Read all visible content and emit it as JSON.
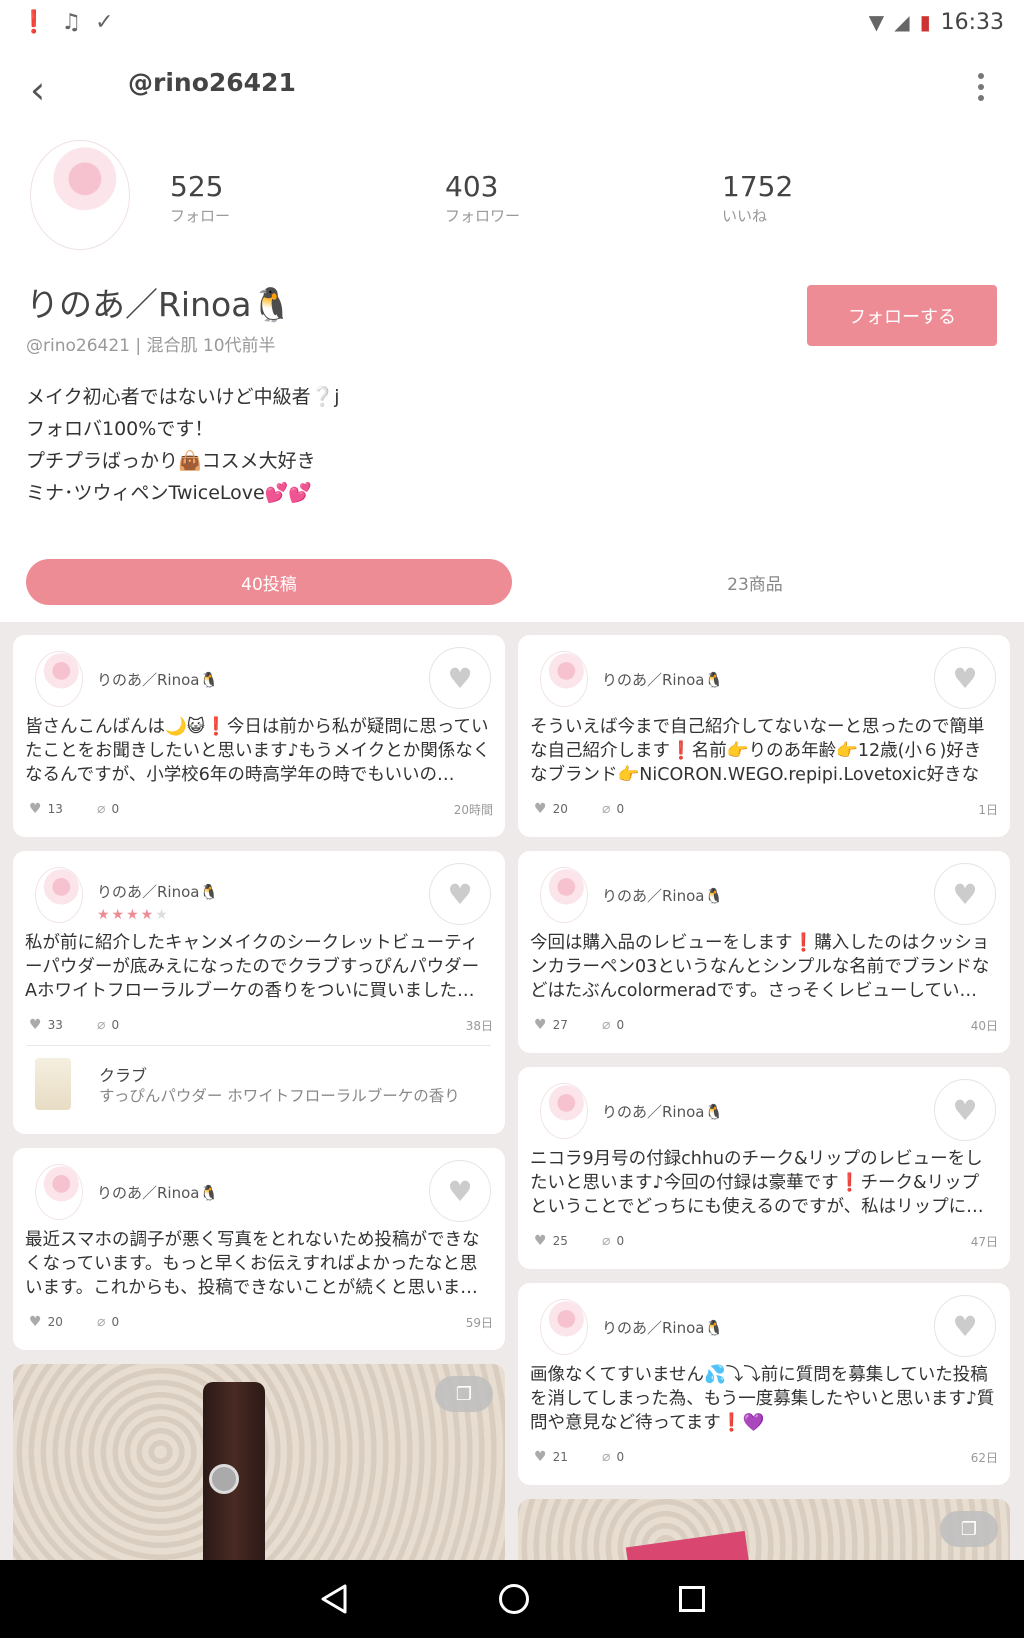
{
  "status_bar": {
    "time": "16:33",
    "left_icons": [
      "alert-icon",
      "notification-icon",
      "notification-icon"
    ]
  },
  "header": {
    "title": "@rino26421"
  },
  "profile": {
    "stats": [
      {
        "value": "525",
        "label": "フォロー"
      },
      {
        "value": "403",
        "label": "フォロワー"
      },
      {
        "value": "1752",
        "label": "いいね"
      }
    ],
    "display_name": "りのあ／Rinoa🐧",
    "follow_label": "フォローする",
    "meta": "@rino26421 | 混合肌 10代前半",
    "bio": [
      "メイク初心者ではないけど中級者❔j",
      "フォロバ100%です！",
      "プチプラばっかり👜コスメ大好き",
      "ミナ･ツウィペンTwiceLove💕💕"
    ]
  },
  "tabs": [
    {
      "label": "40投稿",
      "active": true
    },
    {
      "label": "23商品",
      "active": false
    }
  ],
  "posts_left": [
    {
      "user": "りのあ／Rinoa🐧",
      "text": "皆さんこんばんは🌙😺❗今日は前から私が疑問に思っていたことをお聞きしたいと思います♪もうメイクとか関係なくなるんですが、小学校6年の時高学年の時でもいいの…",
      "likes": "13",
      "clips": "0",
      "time": "20時間"
    },
    {
      "user": "りのあ／Rinoa🐧",
      "stars": 4,
      "text": "私が前に紹介したキャンメイクのシークレットビューティーパウダーが底みえになったのでクラブすっぴんパウダーAホワイトフローラルブーケの香りをついに買いました…",
      "likes": "33",
      "clips": "0",
      "time": "38日",
      "product": {
        "name": "クラブ",
        "desc": "すっぴんパウダー ホワイトフローラルブーケの香り"
      }
    },
    {
      "user": "りのあ／Rinoa🐧",
      "text": "最近スマホの調子が悪く写真をとれないため投稿ができなくなっています。もっと早くお伝えすればよかったなと思います。これからも、投稿できないことが続くと思いま…",
      "likes": "20",
      "clips": "0",
      "time": "59日"
    }
  ],
  "posts_right": [
    {
      "user": "りのあ／Rinoa🐧",
      "text": "そういえば今まで自己紹介してないなーと思ったので簡単な自己紹介します❗名前👉りのあ年齢👉12歳(小６)好きなブランド👉NiCORON.WEGO.repipi.Lovetoxic好きな色👉…",
      "likes": "20",
      "clips": "0",
      "time": "1日"
    },
    {
      "user": "りのあ／Rinoa🐧",
      "text": "今回は購入品のレビューをします❗購入したのはクッションカラーペン03というなんとシンプルな名前でブランドなどはたぶんcolormeradです。さっそくレビューしてい…",
      "likes": "27",
      "clips": "0",
      "time": "40日"
    },
    {
      "user": "りのあ／Rinoa🐧",
      "text": "ニコラ9月号の付録chhuのチーク&リップのレビューをしたいと思います♪今回の付録は豪華です❗チーク&リップということでどっちにも使えるのですが、私はリップに…",
      "likes": "25",
      "clips": "0",
      "time": "47日"
    },
    {
      "user": "りのあ／Rinoa🐧",
      "text": "画像なくてすいません💦⤵⤵前に質問を募集していた投稿を消してしまった為、もう一度募集したやいと思います♪質問や意見など待ってます❗💜",
      "likes": "21",
      "clips": "0",
      "time": "62日"
    }
  ]
}
